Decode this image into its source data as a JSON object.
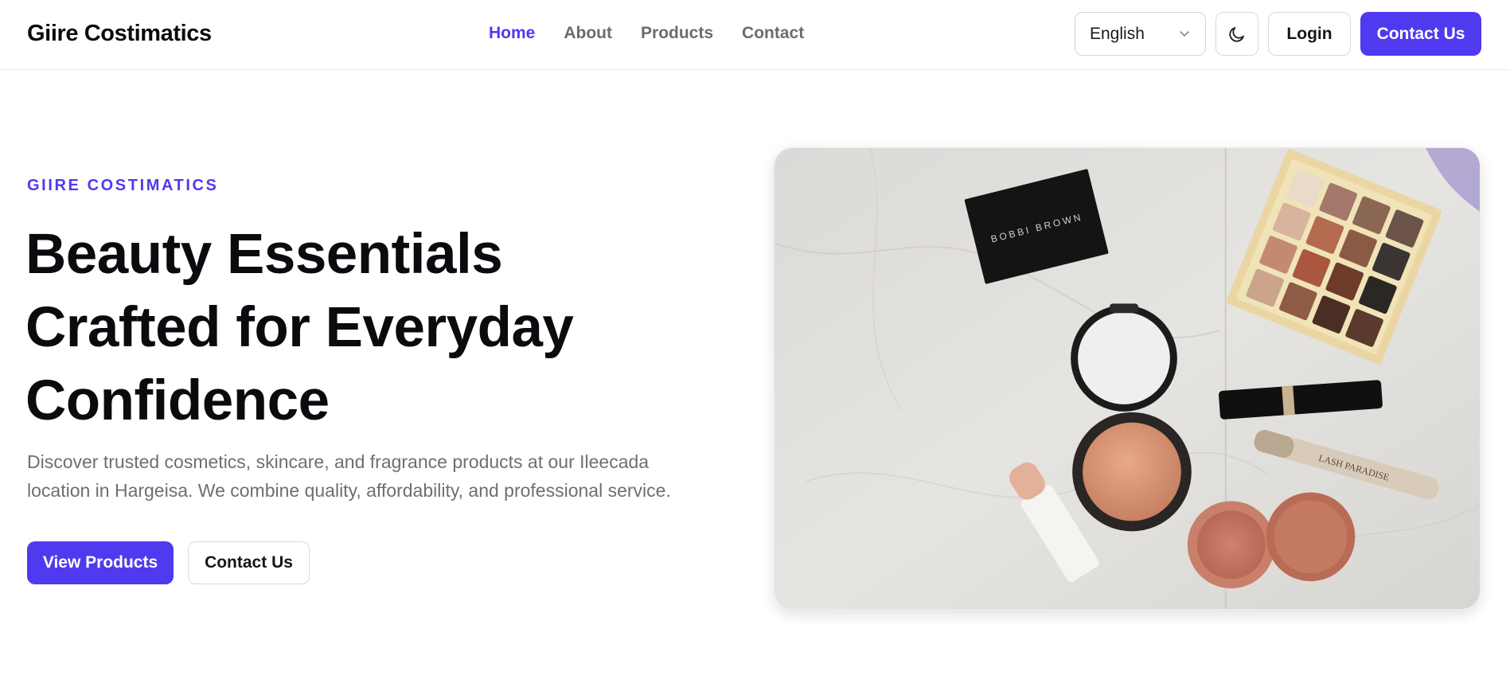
{
  "header": {
    "brand": "Giire Costimatics",
    "nav": [
      {
        "label": "Home",
        "active": true
      },
      {
        "label": "About",
        "active": false
      },
      {
        "label": "Products",
        "active": false
      },
      {
        "label": "Contact",
        "active": false
      }
    ],
    "language": {
      "selected": "English"
    },
    "theme_icon": "moon-icon",
    "login_label": "Login",
    "contact_label": "Contact Us"
  },
  "hero": {
    "eyebrow": "GIIRE COSTIMATICS",
    "title_lines": [
      "Beauty Essentials",
      "Crafted for Everyday",
      "Confidence"
    ],
    "description_lines": [
      "Discover trusted cosmetics, skincare, and fragrance products at our Ileecada",
      "location in Hargeisa. We combine quality, affordability, and professional service."
    ],
    "primary_button": "View Products",
    "secondary_button": "Contact Us",
    "image_brand_text": "BOBBI BROWN"
  },
  "colors": {
    "accent": "#4f3aef",
    "text": "#0b0b0f",
    "muted": "#6e6e76",
    "border": "#d9d9df"
  }
}
